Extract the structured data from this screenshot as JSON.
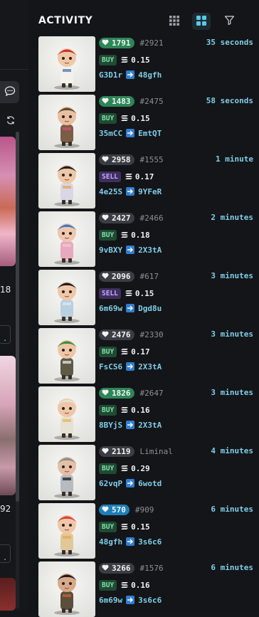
{
  "sidebar": {
    "cards": [
      {
        "value": "18"
      },
      {
        "value": "92"
      }
    ],
    "chip_label": "."
  },
  "activity": {
    "title": "ACTIVITY"
  },
  "rows": [
    {
      "likes": "1791",
      "like_style": "green",
      "rank": "#2921",
      "time": "35 seconds",
      "type": "BUY",
      "type_style": "buy",
      "price": "0.15",
      "from": "G3D1r",
      "to": "48gfh",
      "art": {
        "bg1": "#f7f7f5",
        "bg2": "#e0e0dc",
        "hat": "#c9302c",
        "face": "#f1c8a6",
        "body": "#f3f1ec",
        "accent": "#3a6fb0"
      }
    },
    {
      "likes": "1483",
      "like_style": "green",
      "rank": "#2475",
      "time": "58 seconds",
      "type": "BUY",
      "type_style": "buy",
      "price": "0.15",
      "from": "35mCC",
      "to": "EmtQT",
      "art": {
        "bg1": "#f3c7d8",
        "bg2": "#e9a6bf",
        "hat": "#5b4a3a",
        "face": "#e9bfa0",
        "body": "#7a5d45",
        "accent": "#d94f79"
      }
    },
    {
      "likes": "2958",
      "like_style": "gray",
      "rank": "#1555",
      "time": "1 minute",
      "type": "SELL",
      "type_style": "sell",
      "price": "0.17",
      "from": "4e25S",
      "to": "9YFeR",
      "art": {
        "bg1": "#2a2238",
        "bg2": "#0f0d16",
        "hat": "#1d1d24",
        "face": "#eec7a6",
        "body": "#d9d6e6",
        "accent": "#e1a24a"
      }
    },
    {
      "likes": "2427",
      "like_style": "gray",
      "rank": "#2466",
      "time": "2 minutes",
      "type": "BUY",
      "type_style": "buy",
      "price": "0.18",
      "from": "9vBXY",
      "to": "2X3tA",
      "art": {
        "bg1": "#2c2a2e",
        "bg2": "#121214",
        "hat": "#3b78c4",
        "face": "#efc7ad",
        "body": "#e8a8bd",
        "accent": "#f2c9d6"
      }
    },
    {
      "likes": "2096",
      "like_style": "gray",
      "rank": "#617",
      "time": "3 minutes",
      "type": "SELL",
      "type_style": "sell",
      "price": "0.15",
      "from": "6m69w",
      "to": "Dgd8u",
      "art": {
        "bg1": "#1a1c26",
        "bg2": "#05060a",
        "hat": "#19191d",
        "face": "#efc8a8",
        "body": "#b8d0e0",
        "accent": "#e8e6ee"
      }
    },
    {
      "likes": "2476",
      "like_style": "gray",
      "rank": "#2330",
      "time": "3 minutes",
      "type": "BUY",
      "type_style": "buy",
      "price": "0.17",
      "from": "FsCS6",
      "to": "2X3tA",
      "art": {
        "bg1": "#3a3d43",
        "bg2": "#1c1d21",
        "hat": "#3e8b3e",
        "face": "#efc6a6",
        "body": "#5e5a46",
        "accent": "#f1f1f1"
      }
    },
    {
      "likes": "1826",
      "like_style": "green",
      "rank": "#2647",
      "time": "3 minutes",
      "type": "BUY",
      "type_style": "buy",
      "price": "0.16",
      "from": "8BYjS",
      "to": "2X3tA",
      "art": {
        "bg1": "#2f4a2e",
        "bg2": "#132016",
        "hat": "#e6e2d4",
        "face": "#efc6a6",
        "body": "#e6e1d2",
        "accent": "#e0b651"
      }
    },
    {
      "likes": "2119",
      "like_style": "gray",
      "rank": "Liminal",
      "time": "4 minutes",
      "type": "BUY",
      "type_style": "buy",
      "price": "0.29",
      "from": "62vqP",
      "to": "6wotd",
      "art": {
        "bg1": "#f2f2f2",
        "bg2": "#dcdcdc",
        "hat": "#8a8d93",
        "face": "#e6bfa4",
        "body": "#b7babf",
        "accent": "#111114"
      }
    },
    {
      "likes": "570",
      "like_style": "blue",
      "rank": "#909",
      "time": "6 minutes",
      "type": "BUY",
      "type_style": "buy",
      "price": "0.15",
      "from": "48gfh",
      "to": "3s6c6",
      "art": {
        "bg1": "#3b3a20",
        "bg2": "#12120a",
        "hat": "#d8423a",
        "face": "#efc6a6",
        "body": "#e2c79b",
        "accent": "#e8a93a"
      }
    },
    {
      "likes": "3266",
      "like_style": "gray",
      "rank": "#1576",
      "time": "6 minutes",
      "type": "BUY",
      "type_style": "buy",
      "price": "0.16",
      "from": "6m69w",
      "to": "3s6c6",
      "art": {
        "bg1": "#4d6b5e",
        "bg2": "#1f2d28",
        "hat": "#1b1b1d",
        "face": "#d9a989",
        "body": "#5b4e3a",
        "accent": "#c9672f"
      }
    }
  ],
  "icons": {
    "chat": "chat-bubble-icon",
    "refresh": "refresh-icon",
    "list_view": "grid-3x3-icon",
    "grid_view": "grid-2x2-icon",
    "filter": "filter-icon",
    "heart": "heart-icon",
    "currency": "solana-icon",
    "arrow": "arrow-right-icon"
  },
  "colors": {
    "accent": "#7fcde8",
    "buy": "#7fe0a4",
    "sell": "#c8a8ff",
    "likes_green": "#2d8656",
    "likes_gray": "#3a3d43",
    "likes_blue": "#1e7fb8"
  }
}
